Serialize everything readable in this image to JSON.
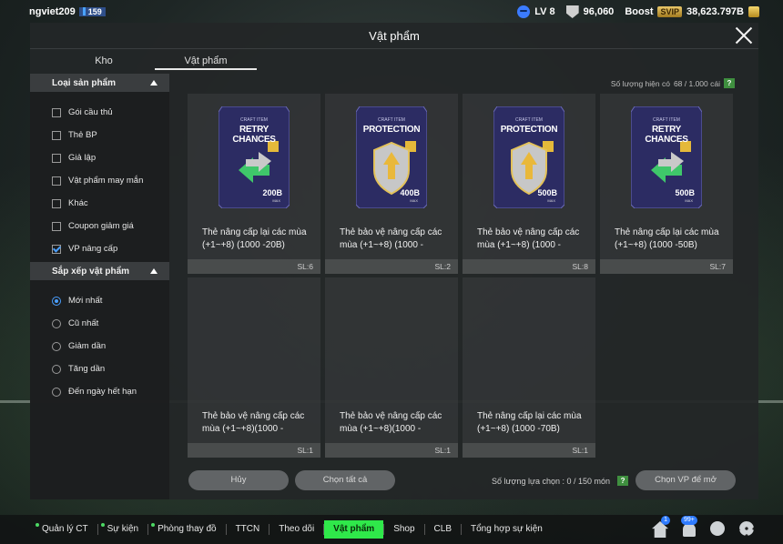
{
  "topbar": {
    "username": "ngviet209",
    "user_badge": "159",
    "level": "LV 8",
    "points": "96,060",
    "boost_label": "Boost",
    "svip": "SVIP",
    "coins": "38,623.797B"
  },
  "panel": {
    "title": "Vật phẩm",
    "tabs": [
      "Kho",
      "Vật phẩm"
    ],
    "quantity_label": "Số lượng hiện có",
    "quantity_value": "68 / 1.000 cái"
  },
  "sidebar": {
    "category_header": "Loại sản phẩm",
    "categories": [
      {
        "label": "Gói cầu thủ",
        "checked": false
      },
      {
        "label": "Thẻ BP",
        "checked": false
      },
      {
        "label": "Giả lập",
        "checked": false
      },
      {
        "label": "Vật phẩm may mắn",
        "checked": false
      },
      {
        "label": "Khác",
        "checked": false
      },
      {
        "label": "Coupon giảm giá",
        "checked": false
      },
      {
        "label": "VP nâng cấp",
        "checked": true
      }
    ],
    "sort_header": "Sắp xếp vật phẩm",
    "sorts": [
      {
        "label": "Mới nhất",
        "selected": true
      },
      {
        "label": "Cũ nhất",
        "selected": false
      },
      {
        "label": "Giảm dần",
        "selected": false
      },
      {
        "label": "Tăng dần",
        "selected": false
      },
      {
        "label": "Đến ngày hết hạn",
        "selected": false
      }
    ]
  },
  "items": [
    {
      "type": "retry",
      "art_sub": "CRAFT ITEM",
      "art_title": "RETRY CHANCES",
      "art_num": "200B",
      "art_num_sub": "MAX",
      "name_line1": "Thẻ nâng cấp lại các mùa",
      "name_line2": "(+1~+8) (1000 -20B)",
      "sl": "SL:6"
    },
    {
      "type": "protect",
      "art_sub": "CRAFT ITEM",
      "art_title": "PROTECTION",
      "art_num": "400B",
      "art_num_sub": "MAX",
      "name_line1": "Thẻ bảo vệ nâng cấp các",
      "name_line2": "mùa (+1~+8) (1000 -",
      "sl": "SL:2"
    },
    {
      "type": "protect",
      "art_sub": "CRAFT ITEM",
      "art_title": "PROTECTION",
      "art_num": "500B",
      "art_num_sub": "MAX",
      "name_line1": "Thẻ bảo vệ nâng cấp các",
      "name_line2": "mùa (+1~+8) (1000 -",
      "sl": "SL:8"
    },
    {
      "type": "retry",
      "art_sub": "CRAFT ITEM",
      "art_title": "RETRY CHANCES",
      "art_num": "500B",
      "art_num_sub": "MAX",
      "name_line1": "Thẻ nâng cấp lại các mùa",
      "name_line2": "(+1~+8) (1000 -50B)",
      "sl": "SL:7"
    },
    {
      "type": "none",
      "name_line1": "Thẻ bảo vệ nâng cấp các",
      "name_line2": "mùa (+1~+8)(1000 -",
      "sl": "SL:1"
    },
    {
      "type": "none",
      "name_line1": "Thẻ bảo vệ nâng cấp các",
      "name_line2": "mùa (+1~+8)(1000 -",
      "sl": "SL:1"
    },
    {
      "type": "none",
      "name_line1": "Thẻ nâng cấp lại các mùa",
      "name_line2": "(+1~+8) (1000 -70B)",
      "sl": "SL:1"
    }
  ],
  "controls": {
    "cancel": "Hủy",
    "select_all": "Chọn tất cả",
    "selected_count": "Số lượng lựa chọn : 0 / 150 món",
    "open": "Chọn VP để mở"
  },
  "bottomnav": {
    "items": [
      {
        "label": "Quản lý CT",
        "dot": true
      },
      {
        "label": "Sự kiện",
        "dot": true
      },
      {
        "label": "Phòng thay đồ",
        "dot": true
      },
      {
        "label": "TTCN",
        "dot": false
      },
      {
        "label": "Theo dõi",
        "dot": false
      },
      {
        "label": "Vật phẩm",
        "dot": false,
        "active": true
      },
      {
        "label": "Shop",
        "dot": false
      },
      {
        "label": "CLB",
        "dot": false
      },
      {
        "label": "Tổng hợp sự kiện",
        "dot": false
      }
    ],
    "home_badge": "1",
    "bell_badge": "99+"
  },
  "help_glyph": "?"
}
